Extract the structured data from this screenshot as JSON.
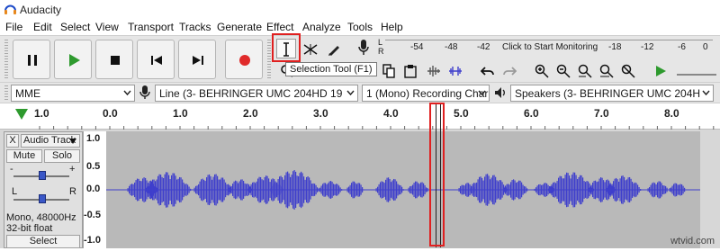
{
  "app": {
    "title": "Audacity"
  },
  "menu": [
    "File",
    "Edit",
    "Select",
    "View",
    "Transport",
    "Tracks",
    "Generate",
    "Effect",
    "Analyze",
    "Tools",
    "Help"
  ],
  "transport": {
    "pause_icon": "pause-icon",
    "play_icon": "play-icon",
    "stop_icon": "stop-icon",
    "skip_start_icon": "skip-to-start-icon",
    "skip_end_icon": "skip-to-end-icon",
    "record_icon": "record-icon"
  },
  "meter": {
    "record_channel_top": "L",
    "record_channel_bottom": "R",
    "scale": [
      "-54",
      "-48",
      "-42",
      "-18",
      "-12",
      "-6",
      "0"
    ],
    "monitor_text": "Click to Start Monitoring"
  },
  "tooltip": {
    "text": "Selection Tool (F1)"
  },
  "device": {
    "host": "MME",
    "input": "Line (3- BEHRINGER UMC 204HD 19",
    "channels": "1 (Mono) Recording Char",
    "output": "Speakers (3- BEHRINGER UMC 204H"
  },
  "timeline": {
    "ticks": [
      "1.0",
      "0.0",
      "1.0",
      "2.0",
      "3.0",
      "4.0",
      "5.0",
      "6.0",
      "7.0",
      "8.0"
    ]
  },
  "track": {
    "name": "Audio Track",
    "mute": "Mute",
    "solo": "Solo",
    "minus": "-",
    "plus": "+",
    "pan_left": "L",
    "pan_right": "R",
    "info_rate": "Mono, 48000Hz",
    "info_format": "32-bit float",
    "select": "Select",
    "close": "X"
  },
  "vertical_ruler": [
    "1.0",
    "0.5",
    "0.0",
    "-0.5",
    "-1.0"
  ],
  "colors": {
    "accent_red": "#e02020",
    "waveform": "#3f3fcc",
    "play_green": "#2e9a2e",
    "record_red": "#e02a2a"
  },
  "watermark": "wtvid.com"
}
